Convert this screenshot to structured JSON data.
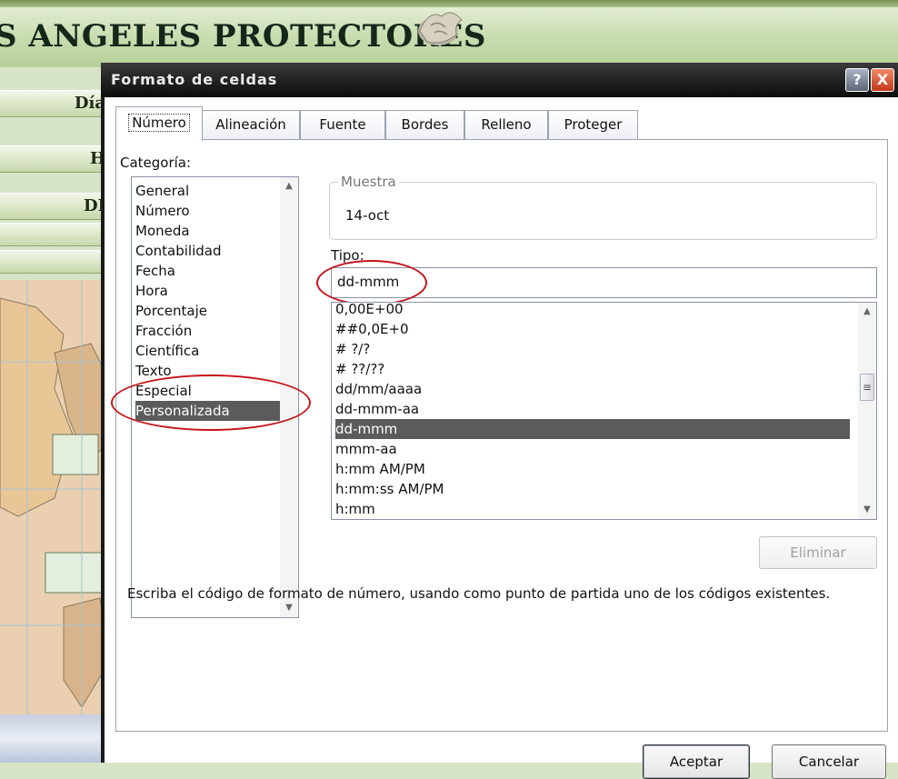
{
  "background_page": {
    "site_title": "S ANGELES PROTECTORES",
    "menu_items": [
      "Día",
      "H",
      "DI"
    ]
  },
  "dialog": {
    "title": "Formato de celdas",
    "help_glyph": "?",
    "close_glyph": "X",
    "tabs": [
      {
        "label": "Número",
        "active": true
      },
      {
        "label": "Alineación"
      },
      {
        "label": "Fuente"
      },
      {
        "label": "Bordes"
      },
      {
        "label": "Relleno"
      },
      {
        "label": "Proteger"
      }
    ],
    "category_label": "Categoría:",
    "categories": [
      "General",
      "Número",
      "Moneda",
      "Contabilidad",
      "Fecha",
      "Hora",
      "Porcentaje",
      "Fracción",
      "Científica",
      "Texto",
      "Especial",
      "Personalizada"
    ],
    "selected_category": "Personalizada",
    "sample": {
      "label": "Muestra",
      "value": "14-oct"
    },
    "type_label": "Tipo:",
    "type_value": "dd-mmm",
    "formats": [
      "0,00E+00",
      "##0,0E+0",
      "# ?/?",
      "# ??/??",
      "dd/mm/aaaa",
      "dd-mmm-aa",
      "dd-mmm",
      "mmm-aa",
      "h:mm AM/PM",
      "h:mm:ss AM/PM",
      "h:mm"
    ],
    "selected_format": "dd-mmm",
    "delete_button": "Eliminar",
    "description": "Escriba el código de formato de número, usando como punto de partida uno de los códigos existentes.",
    "ok_button": "Aceptar",
    "cancel_button": "Cancelar"
  },
  "colors": {
    "selection": "#5b5b5b",
    "annotation_circle": "#c6141a",
    "titlebar": "#1a1a1a"
  }
}
